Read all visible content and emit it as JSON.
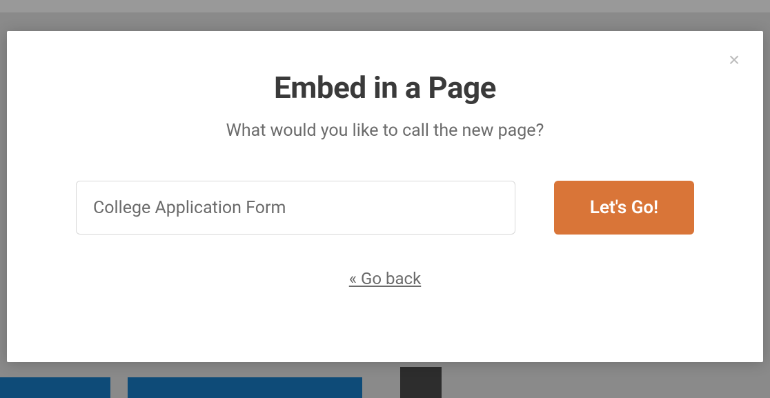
{
  "modal": {
    "title": "Embed in a Page",
    "subtitle": "What would you like to call the new page?",
    "input_value": "College Application Form",
    "lets_go_label": "Let's Go!",
    "go_back_label": "« Go back",
    "close_symbol": "×"
  }
}
